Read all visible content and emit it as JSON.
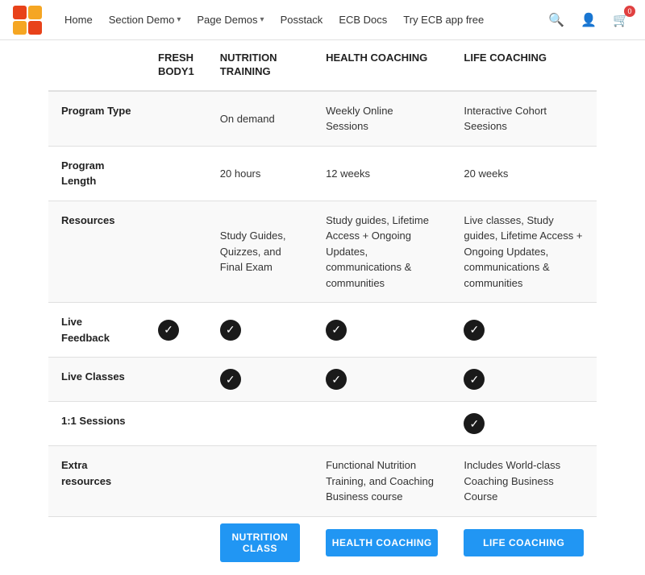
{
  "navbar": {
    "links": [
      {
        "label": "Home",
        "hasDropdown": false
      },
      {
        "label": "Section Demo",
        "hasDropdown": true
      },
      {
        "label": "Page Demos",
        "hasDropdown": true
      },
      {
        "label": "Posstack",
        "hasDropdown": false
      },
      {
        "label": "ECB Docs",
        "hasDropdown": false
      },
      {
        "label": "Try ECB app free",
        "hasDropdown": false
      }
    ],
    "cart_count": "0"
  },
  "logo": {
    "colors": [
      "#E8421A",
      "#F5A623",
      "#E8421A",
      "#F5A623"
    ]
  },
  "table": {
    "columns": [
      {
        "key": "label",
        "header": "",
        "subheader": ""
      },
      {
        "key": "fresh",
        "header": "FRESH",
        "subheader": "BODY1"
      },
      {
        "key": "nutrition",
        "header": "NUTRITION",
        "subheader": "TRAINING"
      },
      {
        "key": "health",
        "header": "HEALTH COACHING",
        "subheader": ""
      },
      {
        "key": "life",
        "header": "LIFE COACHING",
        "subheader": ""
      }
    ],
    "rows": [
      {
        "label": "Program Type",
        "fresh": "",
        "nutrition": "On demand",
        "health": "Weekly Online Sessions",
        "life": "Interactive Cohort Seesions"
      },
      {
        "label": "Program Length",
        "fresh": "",
        "nutrition": "20 hours",
        "health": "12 weeks",
        "life": "20 weeks"
      },
      {
        "label": "Resources",
        "fresh": "",
        "nutrition": "Study Guides, Quizzes, and Final Exam",
        "health": "Study guides, Lifetime Access + Ongoing Updates, communications & communities",
        "life": "Live classes, Study guides, Lifetime Access + Ongoing Updates, communications & communities"
      },
      {
        "label": "Live Feedback",
        "fresh": "check",
        "nutrition": "check",
        "health": "check",
        "life": "check"
      },
      {
        "label": "Live Classes",
        "fresh": "",
        "nutrition": "check",
        "health": "check",
        "life": "check"
      },
      {
        "label": "1:1 Sessions",
        "fresh": "",
        "nutrition": "",
        "health": "",
        "life": "check"
      },
      {
        "label": "Extra resources",
        "fresh": "",
        "nutrition": "",
        "health": "Functional Nutrition Training, and Coaching Business course",
        "life": "Includes World-class Coaching Business Course"
      }
    ],
    "buttons": [
      {
        "label": "NUTRITION CLASS",
        "col": "nutrition"
      },
      {
        "label": "HEALTH COACHING",
        "col": "health"
      },
      {
        "label": "LIFE COACHING",
        "col": "life"
      }
    ]
  }
}
